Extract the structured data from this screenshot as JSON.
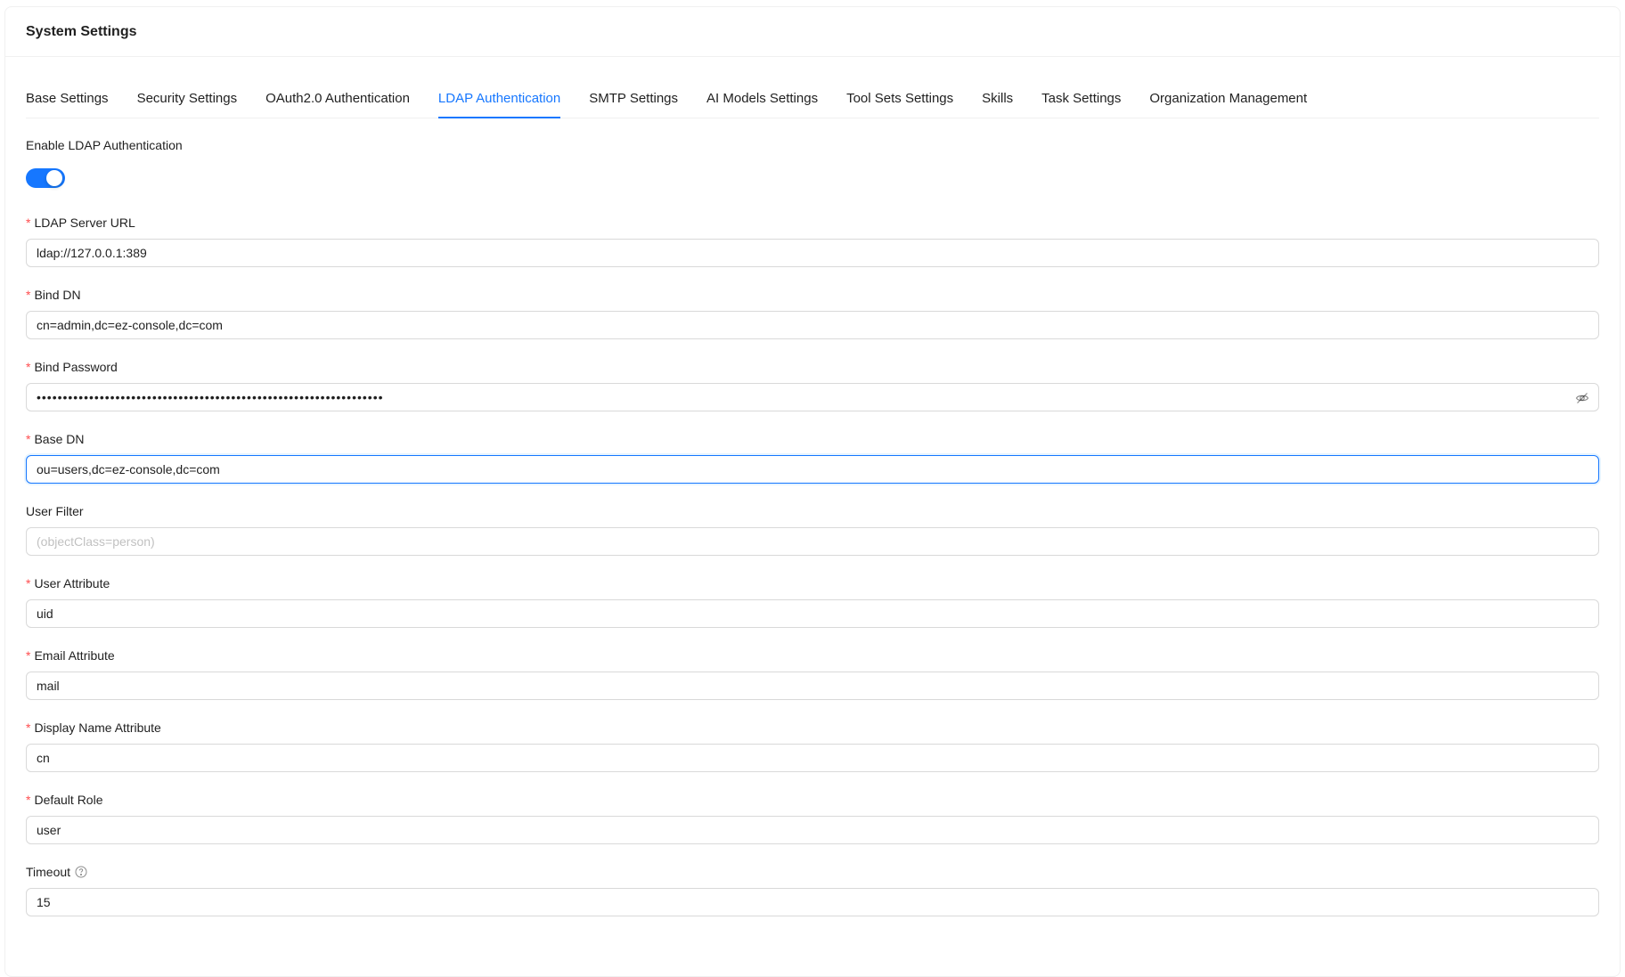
{
  "header": {
    "title": "System Settings"
  },
  "tabs": [
    {
      "label": "Base Settings",
      "active": false
    },
    {
      "label": "Security Settings",
      "active": false
    },
    {
      "label": "OAuth2.0 Authentication",
      "active": false
    },
    {
      "label": "LDAP Authentication",
      "active": true
    },
    {
      "label": "SMTP Settings",
      "active": false
    },
    {
      "label": "AI Models Settings",
      "active": false
    },
    {
      "label": "Tool Sets Settings",
      "active": false
    },
    {
      "label": "Skills",
      "active": false
    },
    {
      "label": "Task Settings",
      "active": false
    },
    {
      "label": "Organization Management",
      "active": false
    }
  ],
  "form": {
    "enable": {
      "label": "Enable LDAP Authentication",
      "checked": true
    },
    "server_url": {
      "label": "LDAP Server URL",
      "value": "ldap://127.0.0.1:389"
    },
    "bind_dn": {
      "label": "Bind DN",
      "value": "cn=admin,dc=ez-console,dc=com"
    },
    "bind_password": {
      "label": "Bind Password",
      "value": "••••••••••••••••••••••••••••••••••••••••••••••••••••••••••••••••••"
    },
    "base_dn": {
      "label": "Base DN",
      "value": "ou=users,dc=ez-console,dc=com"
    },
    "user_filter": {
      "label": "User Filter",
      "value": "",
      "placeholder": "(objectClass=person)"
    },
    "user_attribute": {
      "label": "User Attribute",
      "value": "uid"
    },
    "email_attribute": {
      "label": "Email Attribute",
      "value": "mail"
    },
    "display_name_attribute": {
      "label": "Display Name Attribute",
      "value": "cn"
    },
    "default_role": {
      "label": "Default Role",
      "value": "user"
    },
    "timeout": {
      "label": "Timeout",
      "value": "15"
    }
  },
  "required_mark": "*",
  "icons": {
    "eye": "eye-invisible-icon",
    "help": "question-circle-icon"
  },
  "colors": {
    "accent": "#1677ff",
    "required": "#ff4d4f",
    "border": "#d9d9d9"
  }
}
